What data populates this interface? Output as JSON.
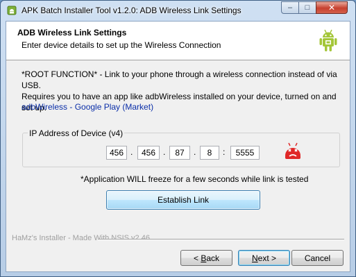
{
  "window": {
    "title": "APK Batch Installer Tool v1.2.0: ADB Wireless Link Settings",
    "min_label": "–",
    "max_label": "□",
    "close_label": "✕"
  },
  "header": {
    "title": "ADB Wireless Link Settings",
    "subtitle": "Enter device details to set up the Wireless Connection"
  },
  "body": {
    "desc_line1": "*ROOT FUNCTION* - Link to your phone through a wireless connection instead of via USB.",
    "desc_line2": "Requires you to have an app like adbWireless installed on your device, turned on and set up.",
    "link": "adbWireless - Google Play (Market)"
  },
  "ip_group": {
    "label": "IP Address of Device (v4)",
    "octet1": "456",
    "octet2": "456",
    "octet3": "87",
    "octet4": "8",
    "port": "5555",
    "sep_dot": ".",
    "sep_colon": ":"
  },
  "freeze_note": "*Application WILL freeze for a few seconds while link is tested",
  "establish_label": "Establish Link",
  "footer": {
    "branding": "HaMz's Installer - Made With NSIS v2.46",
    "back_mnemonic": "B",
    "back_rest": "ack",
    "back_prefix": "< ",
    "next_mnemonic": "N",
    "next_rest": "ext >",
    "cancel_label": "Cancel"
  },
  "colors": {
    "android_green": "#a4c639",
    "error_red": "#e02828",
    "link_blue": "#0a2ea8"
  },
  "icons": {
    "title_icon": "android-icon",
    "header_icon": "android-robot-icon",
    "status_icon": "android-error-icon"
  }
}
